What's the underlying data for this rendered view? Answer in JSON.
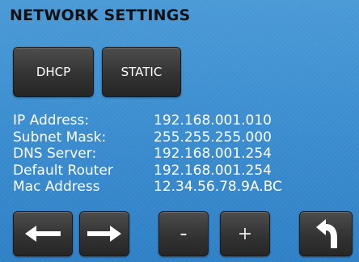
{
  "title": "NETWORK SETTINGS",
  "mode_buttons": {
    "dhcp": "DHCP",
    "static": "STATIC"
  },
  "network_info": [
    {
      "label": "IP Address:",
      "value": "192.168.001.010"
    },
    {
      "label": "Subnet Mask:",
      "value": "255.255.255.000"
    },
    {
      "label": "DNS Server:",
      "value": "192.168.001.254"
    },
    {
      "label": "Default Router",
      "value": "192.168.001.254"
    },
    {
      "label": "Mac Address",
      "value": "12.34.56.78.9A.BC"
    }
  ],
  "controls": {
    "left_icon": "arrow-left-icon",
    "right_icon": "arrow-right-icon",
    "minus_label": "-",
    "plus_label": "+",
    "back_icon": "return-icon"
  },
  "colors": {
    "background": "#3c8ed0",
    "button": "#333333",
    "text": "#ffffff",
    "title": "#111111"
  }
}
